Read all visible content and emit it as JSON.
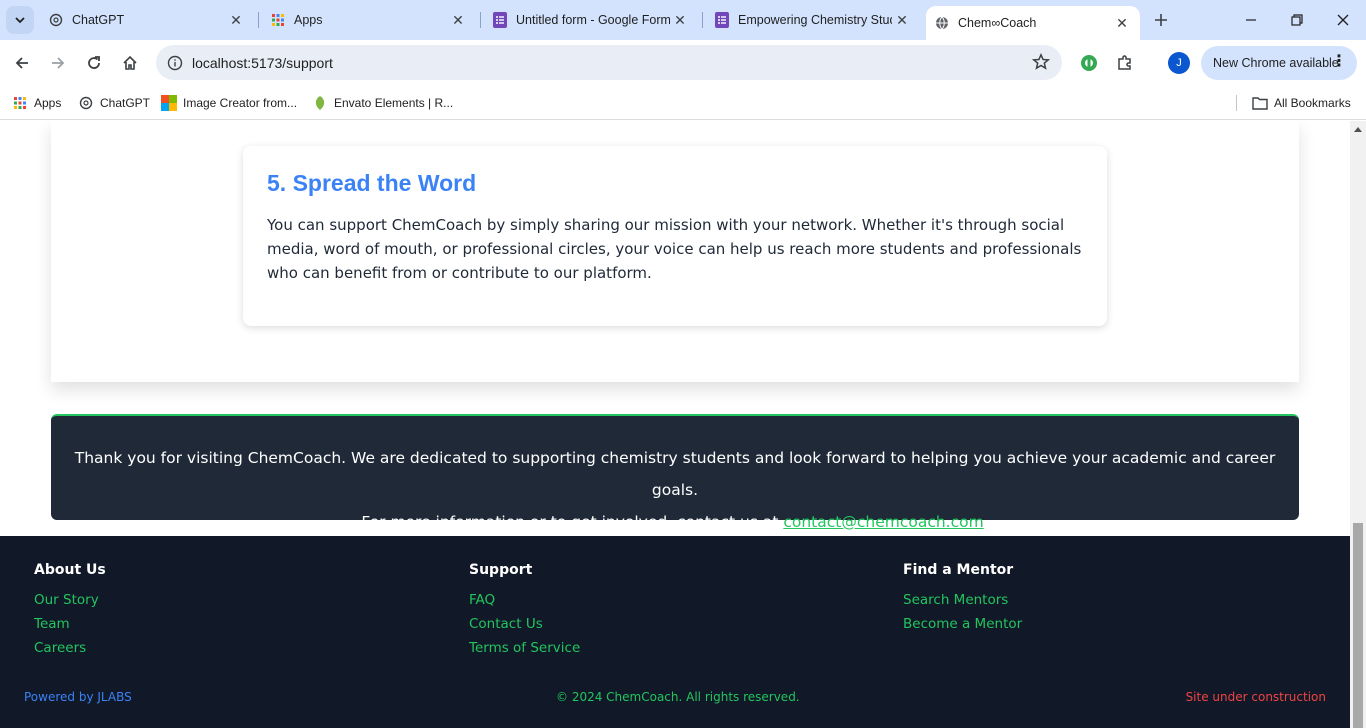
{
  "browser": {
    "tabs": [
      {
        "title": "ChatGPT",
        "icon": "chatgpt-icon"
      },
      {
        "title": "Apps",
        "icon": "apps-grid-icon"
      },
      {
        "title": "Untitled form - Google Forms",
        "icon": "google-forms-icon"
      },
      {
        "title": "Empowering Chemistry Studen",
        "icon": "google-forms-icon"
      },
      {
        "title": "Chem∞Coach",
        "icon": "globe-icon",
        "active": true
      }
    ],
    "url": "localhost:5173/support",
    "update_label": "New Chrome available",
    "profile_initial": "J",
    "bookmarks": [
      {
        "label": "Apps",
        "icon": "apps-grid-icon"
      },
      {
        "label": "ChatGPT",
        "icon": "chatgpt-icon"
      },
      {
        "label": "Image Creator from...",
        "icon": "image-creator-icon"
      },
      {
        "label": "Envato Elements | R...",
        "icon": "envato-leaf-icon"
      }
    ],
    "all_bookmarks_label": "All Bookmarks"
  },
  "card": {
    "heading": "5. Spread the Word",
    "body": "You can support ChemCoach by simply sharing our mission with your network. Whether it's through social media, word of mouth, or professional circles, your voice can help us reach more students and professionals who can benefit from or contribute to our platform."
  },
  "thanks": {
    "line1": "Thank you for visiting ChemCoach. We are dedicated to supporting chemistry students and look forward to helping you achieve your academic and career goals.",
    "line2_prefix": "For more information or to get involved, contact us at ",
    "email": "contact@chemcoach.com",
    "line2_suffix": "."
  },
  "footer": {
    "columns": [
      {
        "heading": "About Us",
        "links": [
          "Our Story",
          "Team",
          "Careers"
        ]
      },
      {
        "heading": "Support",
        "links": [
          "FAQ",
          "Contact Us",
          "Terms of Service"
        ]
      },
      {
        "heading": "Find a Mentor",
        "links": [
          "Search Mentors",
          "Become a Mentor"
        ]
      }
    ],
    "powered_by": "Powered by JLABS",
    "copyright": "© 2024 ChemCoach. All rights reserved.",
    "status": "Site under construction"
  },
  "colors": {
    "accent_blue": "#3b82f6",
    "accent_green": "#22c55e",
    "footer_bg": "#111827",
    "panel_bg": "#1f2937",
    "status_red": "#ef4444",
    "powered_blue": "#3b82f6"
  }
}
